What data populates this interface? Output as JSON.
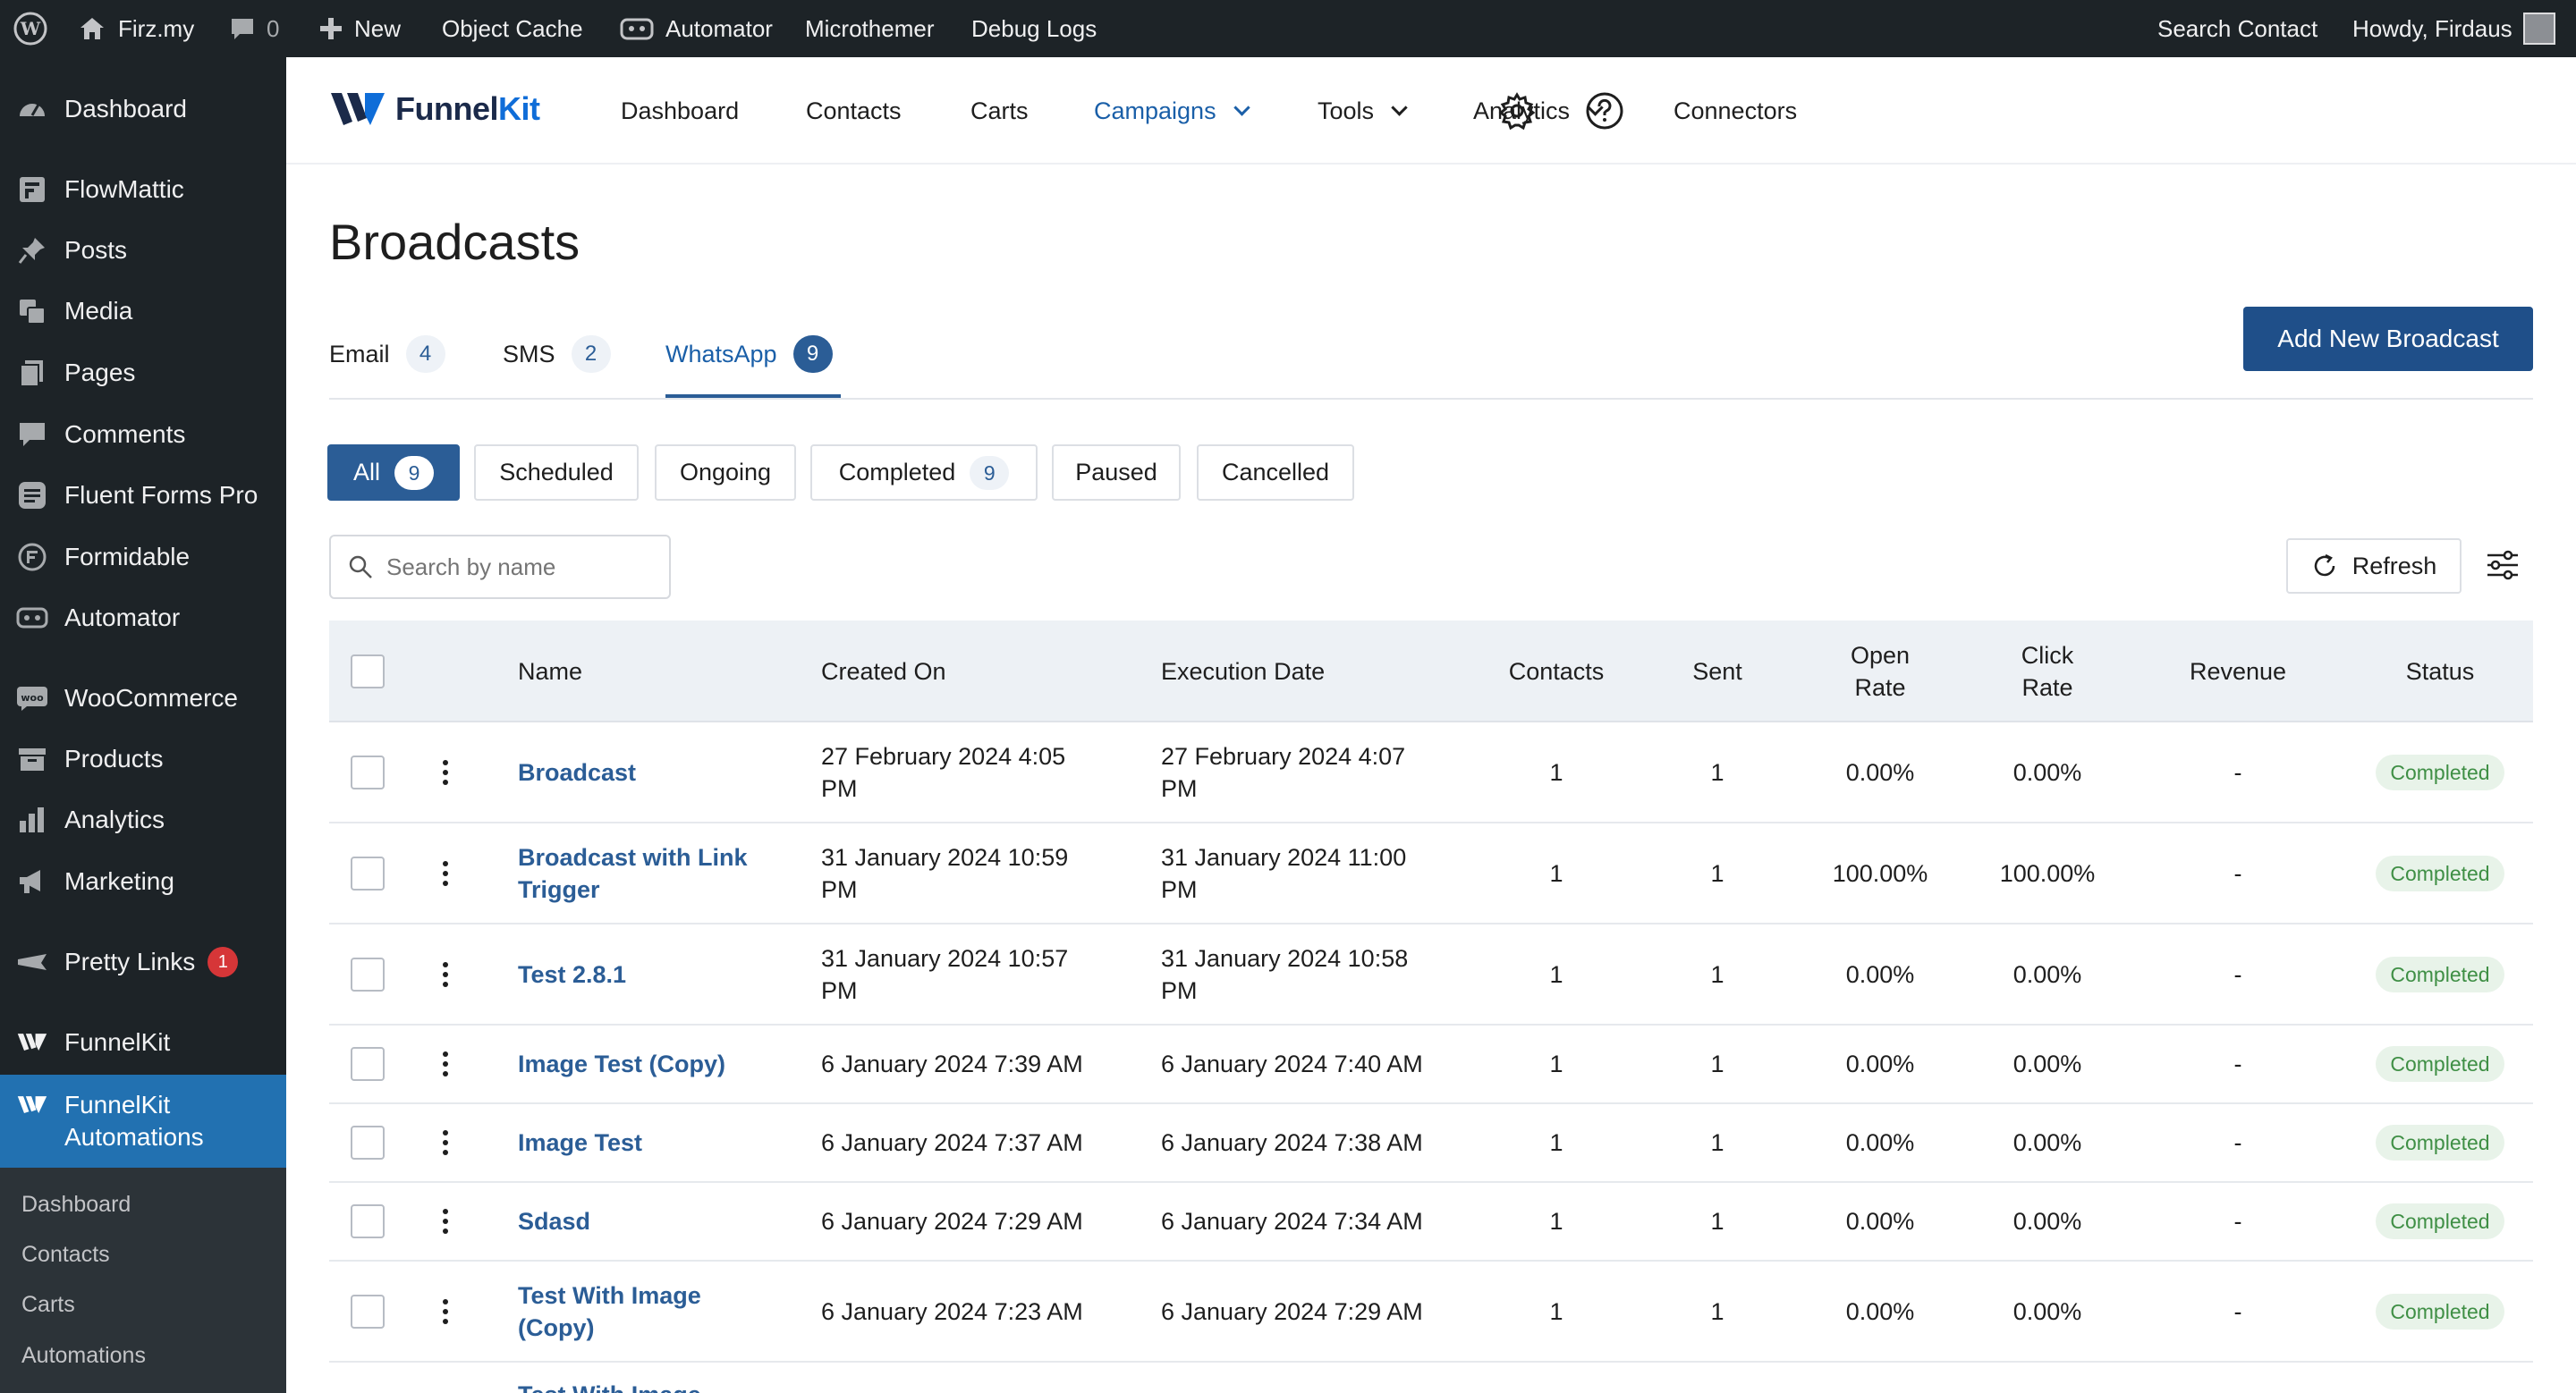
{
  "admin_bar": {
    "site_name": "Firz.my",
    "comments_count": "0",
    "new_label": "New",
    "object_cache": "Object Cache",
    "automator": "Automator",
    "microthemer": "Microthemer",
    "debug_logs": "Debug Logs",
    "search_contact": "Search Contact",
    "howdy": "Howdy, Firdaus"
  },
  "side_menu": {
    "items": [
      {
        "label": "Dashboard",
        "icon": "dashboard-icon"
      },
      {
        "label": "FlowMattic",
        "icon": "flowmattic-icon"
      },
      {
        "label": "Posts",
        "icon": "pin-icon"
      },
      {
        "label": "Media",
        "icon": "media-icon"
      },
      {
        "label": "Pages",
        "icon": "pages-icon"
      },
      {
        "label": "Comments",
        "icon": "comments-icon"
      },
      {
        "label": "Fluent Forms Pro",
        "icon": "forms-icon"
      },
      {
        "label": "Formidable",
        "icon": "formidable-icon"
      },
      {
        "label": "Automator",
        "icon": "automator-icon"
      },
      {
        "label": "WooCommerce",
        "icon": "woocommerce-icon"
      },
      {
        "label": "Products",
        "icon": "products-icon"
      },
      {
        "label": "Analytics",
        "icon": "analytics-icon"
      },
      {
        "label": "Marketing",
        "icon": "megaphone-icon"
      },
      {
        "label": "Pretty Links",
        "icon": "pretty-links-icon",
        "badge": "1"
      },
      {
        "label": "FunnelKit",
        "icon": "funnelkit-icon"
      },
      {
        "label": "FunnelKit Automations",
        "icon": "funnelkit-automations-icon"
      }
    ],
    "submenu": [
      "Dashboard",
      "Contacts",
      "Carts",
      "Automations"
    ]
  },
  "fk_nav": {
    "logo_funnel": "Funnel",
    "logo_kit": "Kit",
    "links": [
      "Dashboard",
      "Contacts",
      "Carts",
      "Campaigns",
      "Tools",
      "Analytics",
      "Connectors"
    ],
    "active": "Campaigns"
  },
  "page": {
    "title": "Broadcasts",
    "add_button": "Add New Broadcast",
    "tabs": [
      {
        "label": "Email",
        "count": "4"
      },
      {
        "label": "SMS",
        "count": "2"
      },
      {
        "label": "WhatsApp",
        "count": "9"
      }
    ],
    "active_tab": "WhatsApp",
    "filters": [
      {
        "label": "All",
        "count": "9"
      },
      {
        "label": "Scheduled"
      },
      {
        "label": "Ongoing"
      },
      {
        "label": "Completed",
        "count": "9"
      },
      {
        "label": "Paused"
      },
      {
        "label": "Cancelled"
      }
    ],
    "active_filter": "All",
    "search_placeholder": "Search by name",
    "refresh_label": "Refresh"
  },
  "table": {
    "headers": {
      "name": "Name",
      "created_on": "Created On",
      "execution_date": "Execution Date",
      "contacts": "Contacts",
      "sent": "Sent",
      "open_rate_1": "Open",
      "open_rate_2": "Rate",
      "click_rate_1": "Click",
      "click_rate_2": "Rate",
      "revenue": "Revenue",
      "status": "Status"
    },
    "rows": [
      {
        "name": "Broadcast",
        "created": "27 February 2024 4:05 PM",
        "executed": "27 February 2024 4:07 PM",
        "contacts": "1",
        "sent": "1",
        "open_rate": "0.00%",
        "click_rate": "0.00%",
        "revenue": "-",
        "status": "Completed"
      },
      {
        "name": "Broadcast with Link Trigger",
        "created": "31 January 2024 10:59 PM",
        "executed": "31 January 2024 11:00 PM",
        "contacts": "1",
        "sent": "1",
        "open_rate": "100.00%",
        "click_rate": "100.00%",
        "revenue": "-",
        "status": "Completed"
      },
      {
        "name": "Test 2.8.1",
        "created": "31 January 2024 10:57 PM",
        "executed": "31 January 2024 10:58 PM",
        "contacts": "1",
        "sent": "1",
        "open_rate": "0.00%",
        "click_rate": "0.00%",
        "revenue": "-",
        "status": "Completed"
      },
      {
        "name": "Image Test (Copy)",
        "created": "6 January 2024 7:39 AM",
        "executed": "6 January 2024 7:40 AM",
        "contacts": "1",
        "sent": "1",
        "open_rate": "0.00%",
        "click_rate": "0.00%",
        "revenue": "-",
        "status": "Completed"
      },
      {
        "name": "Image Test",
        "created": "6 January 2024 7:37 AM",
        "executed": "6 January 2024 7:38 AM",
        "contacts": "1",
        "sent": "1",
        "open_rate": "0.00%",
        "click_rate": "0.00%",
        "revenue": "-",
        "status": "Completed"
      },
      {
        "name": "Sdasd",
        "created": "6 January 2024 7:29 AM",
        "executed": "6 January 2024 7:34 AM",
        "contacts": "1",
        "sent": "1",
        "open_rate": "0.00%",
        "click_rate": "0.00%",
        "revenue": "-",
        "status": "Completed"
      },
      {
        "name": "Test With Image (Copy)",
        "created": "6 January 2024 7:23 AM",
        "executed": "6 January 2024 7:29 AM",
        "contacts": "1",
        "sent": "1",
        "open_rate": "0.00%",
        "click_rate": "0.00%",
        "revenue": "-",
        "status": "Completed"
      },
      {
        "name": "Test With Image",
        "created": "",
        "executed": "",
        "contacts": "",
        "sent": "",
        "open_rate": "",
        "click_rate": "",
        "revenue": "",
        "status": ""
      }
    ]
  },
  "colors": {
    "admin_bg": "#1d2327",
    "wp_blue": "#2271b1",
    "fk_blue": "#2b5d96",
    "primary_button": "#1f4f89",
    "completed_green": "#3f8f45"
  }
}
